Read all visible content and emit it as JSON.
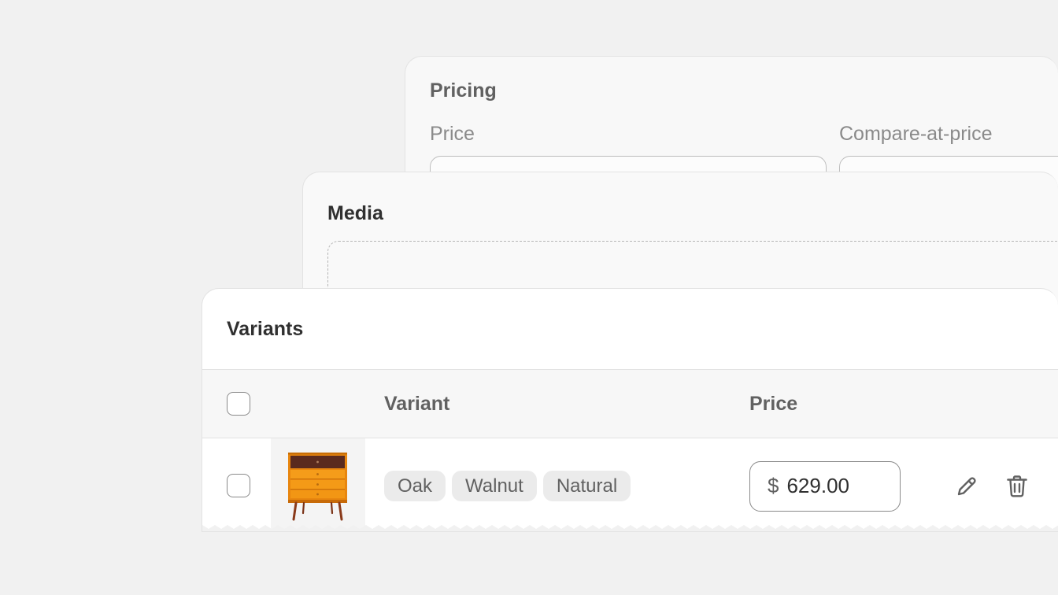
{
  "pricing": {
    "title": "Pricing",
    "price_label": "Price",
    "compare_label": "Compare-at-price"
  },
  "media": {
    "title": "Media"
  },
  "variants": {
    "title": "Variants",
    "columns": {
      "variant": "Variant",
      "price": "Price"
    },
    "rows": [
      {
        "tags": [
          "Oak",
          "Walnut",
          "Natural"
        ],
        "currency_symbol": "$",
        "price": "629.00",
        "checked": false
      }
    ]
  },
  "icons": {
    "edit": "pencil-icon",
    "delete": "trash-icon",
    "thumbnail": "dresser-image"
  },
  "colors": {
    "background": "#f1f1f1",
    "card": "#ffffff",
    "text_primary": "#303030",
    "text_secondary": "#616161"
  }
}
